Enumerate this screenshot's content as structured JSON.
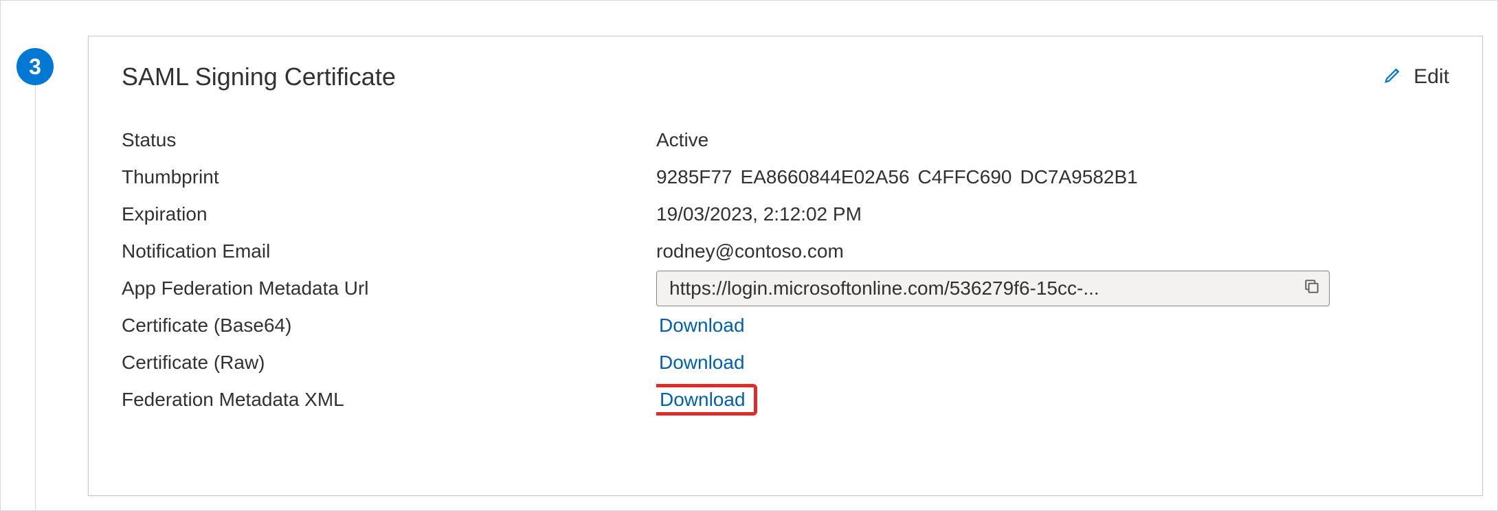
{
  "step": {
    "number": "3"
  },
  "card": {
    "title": "SAML Signing Certificate",
    "edit_label": "Edit"
  },
  "fields": {
    "status": {
      "label": "Status",
      "value": "Active"
    },
    "thumbprint": {
      "label": "Thumbprint",
      "seg1": "9285F77",
      "seg2": "EA8660844E02A56",
      "seg3": "C4FFC690",
      "seg4": "DC7A9582B1"
    },
    "expiration": {
      "label": "Expiration",
      "value": "19/03/2023, 2:12:02 PM"
    },
    "notification_email": {
      "label": "Notification Email",
      "value": "rodney@contoso.com"
    },
    "metadata_url": {
      "label": "App Federation Metadata Url",
      "value": "https://login.microsoftonline.com/536279f6-15cc-..."
    },
    "cert_base64": {
      "label": "Certificate (Base64)",
      "link": "Download"
    },
    "cert_raw": {
      "label": "Certificate (Raw)",
      "link": "Download"
    },
    "fed_xml": {
      "label": "Federation Metadata XML",
      "link": "Download"
    }
  }
}
